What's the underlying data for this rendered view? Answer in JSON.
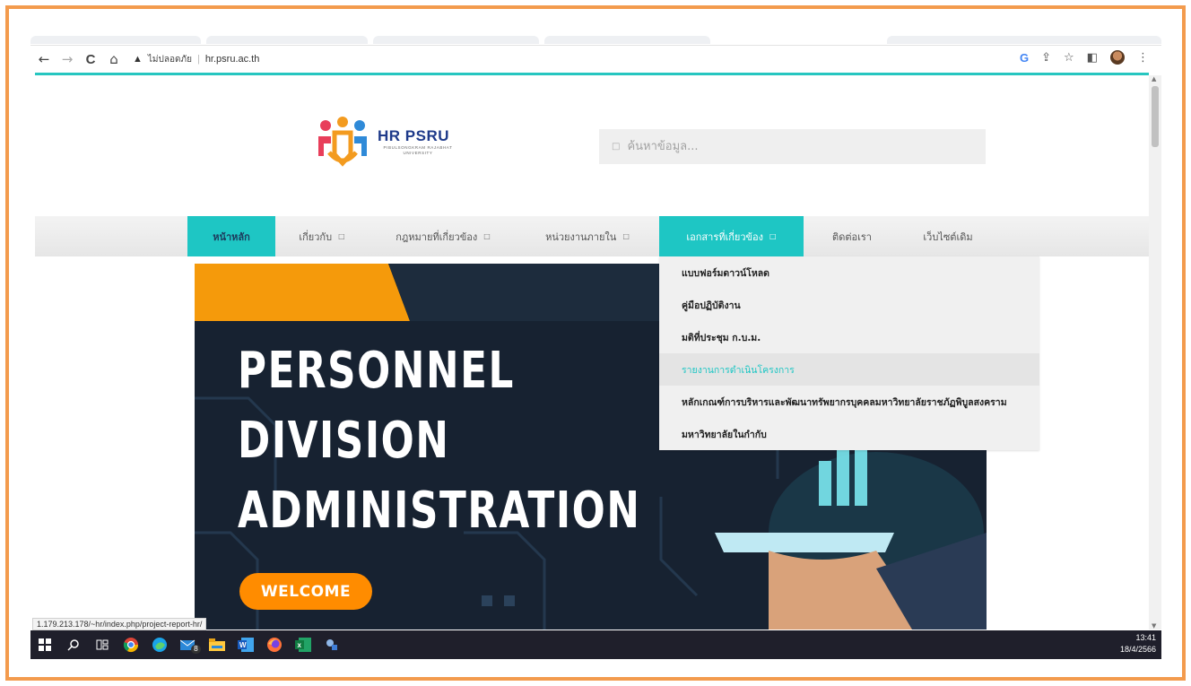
{
  "browser": {
    "back_icon": "←",
    "forward_icon": "→",
    "reload_icon": "C",
    "home_icon": "⌂",
    "warning_icon": "▲",
    "security_label": "ไม่ปลอดภัย",
    "url": "hr.psru.ac.th",
    "right_icons": [
      "G",
      "⇪",
      "☆",
      "◧",
      "⋮"
    ]
  },
  "site": {
    "logo_text": "HR PSRU",
    "logo_sub": "PIBULSONGKRAM RAJABHAT UNIVERSITY",
    "search_placeholder": "ค้นหาข้อมูล...",
    "search_icon": "□"
  },
  "menu": {
    "items": [
      {
        "label": "หน้าหลัก",
        "caret": ""
      },
      {
        "label": "เกี่ยวกับ",
        "caret": "□"
      },
      {
        "label": "กฎหมายที่เกี่ยวข้อง",
        "caret": "□"
      },
      {
        "label": "หน่วยงานภายใน",
        "caret": "□"
      },
      {
        "label": "เอกสารที่เกี่ยวข้อง",
        "caret": "□"
      },
      {
        "label": "ติดต่อเรา",
        "caret": ""
      },
      {
        "label": "เว็บไซต์เดิม",
        "caret": ""
      }
    ]
  },
  "dropdown": {
    "items": [
      "แบบฟอร์มดาวน์โหลด",
      "คู่มือปฏิบัติงาน",
      "มติที่ประชุม ก.บ.ม.",
      "รายงานการดำเนินโครงการ",
      "หลักเกณฑ์การบริหารและพัฒนาทรัพยากรบุคคลมหาวิทยาลัยราชภัฏพิบูลสงคราม",
      "มหาวิทยาลัยในกำกับ"
    ]
  },
  "banner": {
    "line1": "PERSONNEL",
    "line2": "DIVISION",
    "line3": "ADMINISTRATION",
    "welcome": "WELCOME"
  },
  "status_url": "1.179.213.178/~hr/index.php/project-report-hr/",
  "taskbar": {
    "time": "13:41",
    "date": "18/4/2566",
    "mail_badge": "8"
  },
  "colors": {
    "accent": "#1ec6c4",
    "frame": "#f39b4d",
    "banner_bg": "#17202b",
    "welcome": "#ff8c00"
  }
}
